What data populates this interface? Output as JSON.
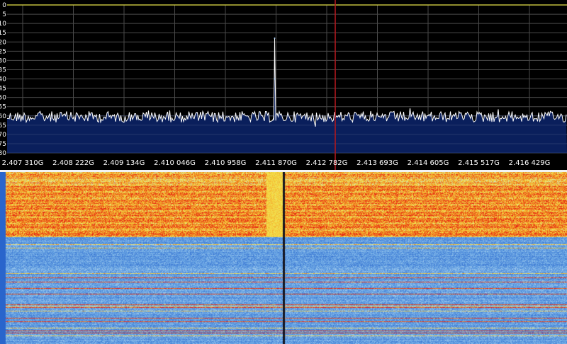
{
  "chart_data": {
    "type": "line",
    "title": "",
    "xlabel": "",
    "ylabel": "",
    "x_tick_labels": [
      "2.407 310G",
      "2.408 222G",
      "2.409 134G",
      "2.410 046G",
      "2.410 958G",
      "2.411 870G",
      "2.412 782G",
      "2.413 693G",
      "2.414 605G",
      "2.415 517G",
      "2.416 429G"
    ],
    "y_tick_labels": [
      "0",
      "5",
      "10",
      "15",
      "20",
      "25",
      "30",
      "35",
      "40",
      "45",
      "50",
      "55",
      "60",
      "65",
      "70",
      "75",
      "80"
    ],
    "ylim": [
      0,
      80
    ],
    "noise_floor": 60.5,
    "series": [
      {
        "values": [
          {
            "freq_label": "2.411 870G",
            "level": 18
          },
          {
            "freq_label": "2.411 870G",
            "level": 40
          }
        ]
      }
    ],
    "marker_freq_label": "2.412 782G",
    "grid": true,
    "colors": {
      "background": "#000000",
      "fill": "#0a1f5c",
      "trace": "#ffffff",
      "grid": "#4a4a4a",
      "marker": "#b0181e",
      "top_line": "#e8e24a",
      "text": "#ffffff"
    }
  },
  "waterfall": {
    "type": "heatmap",
    "colors": {
      "low": "#2a6fd8",
      "mid": "#9ecbe8",
      "warm": "#f2e04a",
      "high": "#e8281a"
    }
  }
}
